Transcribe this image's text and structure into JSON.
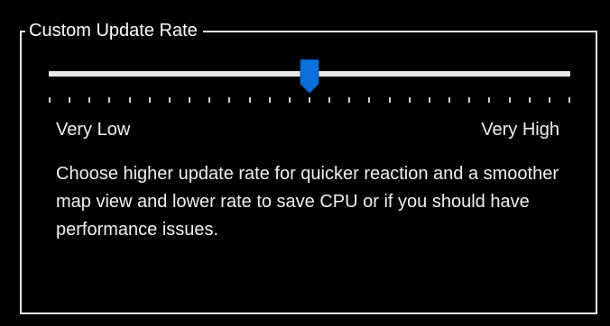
{
  "group": {
    "title": "Custom Update Rate"
  },
  "slider": {
    "value": 0.5,
    "tick_count": 27,
    "accent_color": "#0a6fd8",
    "track_color": "#e8e8e8",
    "min_label": "Very Low",
    "max_label": "Very High"
  },
  "description": "Choose higher update rate for quicker reaction and a smoother map view and lower rate to save CPU or if you should have performance issues."
}
